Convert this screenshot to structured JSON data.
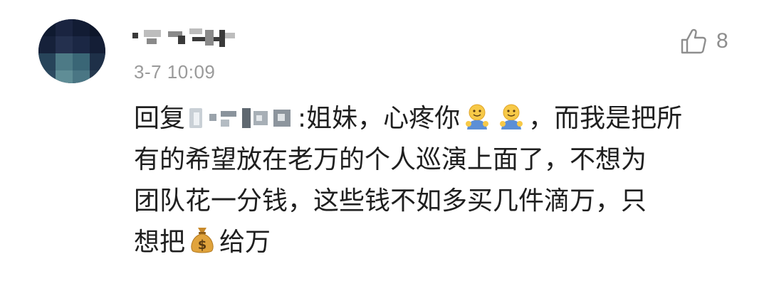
{
  "comment": {
    "timestamp": "3-7 10:09",
    "like_count": "8",
    "reply_prefix": "回复",
    "reply_separator": ":",
    "lines": [
      {
        "before": "姐妹，心疼你",
        "after": "，而我是把所"
      },
      {
        "text": "有的希望放在老万的个人巡演上面了，不想为"
      },
      {
        "text": "团队花一分钱，这些钱不如多买几件滴万，只"
      },
      {
        "before": "想把",
        "after": "给万"
      }
    ],
    "icons": {
      "like": "thumbs-up-icon",
      "emoji_1": "hugging-face-emoji-icon",
      "emoji_2": "hugging-face-emoji-icon",
      "emoji_3": "money-bag-emoji-icon"
    },
    "colors": {
      "text": "#1f1f1f",
      "meta": "#9a9a9a",
      "like": "#8e8e8e"
    }
  }
}
